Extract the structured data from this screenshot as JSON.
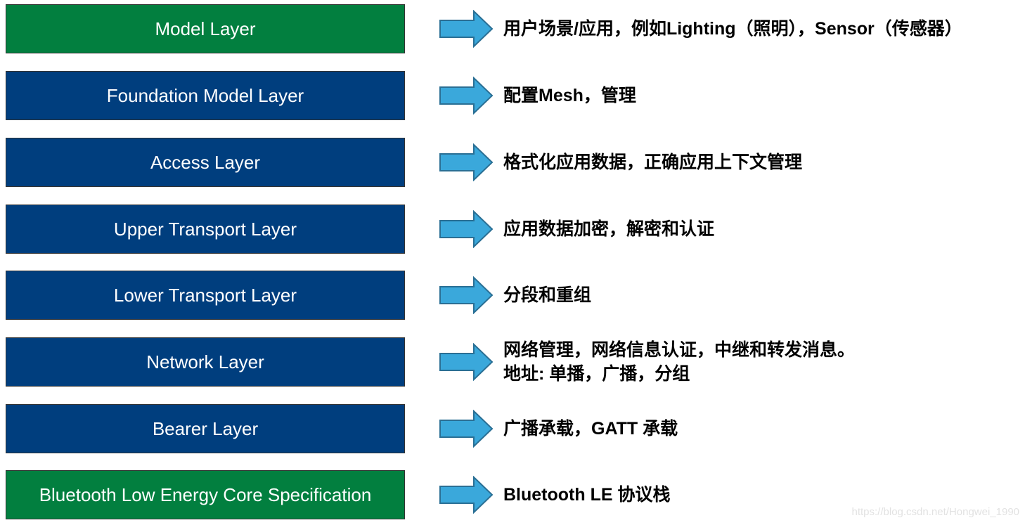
{
  "colors": {
    "green": "#027F3F",
    "blue": "#003E7E",
    "arrow": "#3AA8DB",
    "arrow_border": "#2A6F94"
  },
  "layers": [
    {
      "label": "Model Layer",
      "color": "green",
      "desc": "用户场景/应用，例如Lighting（照明），Sensor（传感器）"
    },
    {
      "label": "Foundation Model Layer",
      "color": "blue",
      "desc": "配置Mesh，管理"
    },
    {
      "label": "Access Layer",
      "color": "blue",
      "desc": "格式化应用数据，正确应用上下文管理"
    },
    {
      "label": "Upper Transport Layer",
      "color": "blue",
      "desc": "应用数据加密，解密和认证"
    },
    {
      "label": "Lower Transport Layer",
      "color": "blue",
      "desc": "分段和重组"
    },
    {
      "label": "Network Layer",
      "color": "blue",
      "desc": "网络管理，网络信息认证，中继和转发消息。\n地址: 单播，广播，分组"
    },
    {
      "label": "Bearer Layer",
      "color": "blue",
      "desc": "广播承载，GATT 承载"
    },
    {
      "label": "Bluetooth Low Energy Core Specification",
      "color": "green",
      "desc": "Bluetooth LE 协议栈"
    }
  ],
  "watermark": "https://blog.csdn.net/Hongwei_1990"
}
